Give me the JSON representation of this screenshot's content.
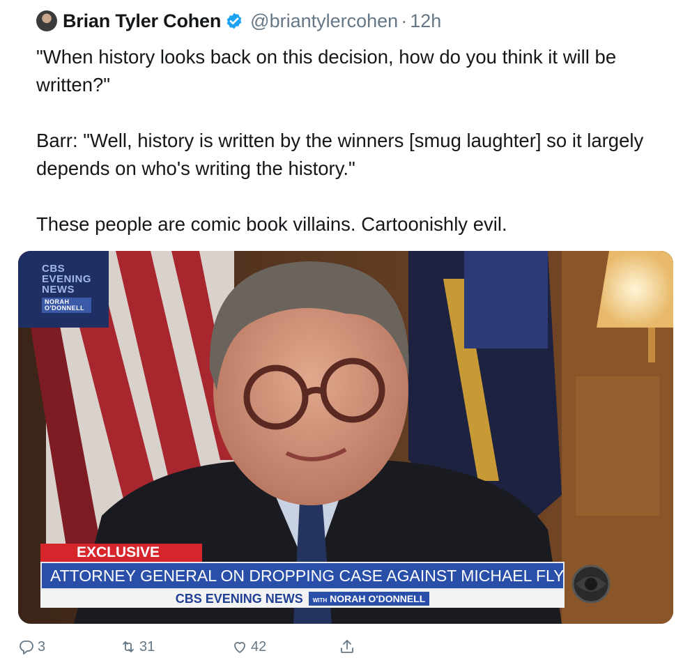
{
  "tweet": {
    "author": {
      "display_name": "Brian Tyler Cohen",
      "handle": "@briantylercohen",
      "separator": "·",
      "time": "12h",
      "verified": true,
      "avatar_icon": "avatar-photo"
    },
    "text": {
      "line1": "\"When history looks back on this decision, how do you think it will be written?\"",
      "line2": "Barr: \"Well, history is written by the winners [smug laughter] so it largely depends on who's writing the history.\"",
      "line3": "These people are comic book villains. Cartoonishly evil."
    },
    "media": {
      "network_logo": {
        "line1": "CBS",
        "line2": "EVENING",
        "line3": "NEWS",
        "anchor_line1": "NORAH",
        "anchor_line2": "O'DONNELL"
      },
      "lower_third": {
        "tag": "EXCLUSIVE",
        "headline": "ATTORNEY GENERAL ON DROPPING CASE AGAINST MICHAEL FLYNN",
        "program": "CBS EVENING NEWS",
        "with_label": "WITH",
        "anchor": "NORAH O'DONNELL"
      }
    },
    "actions": {
      "reply_count": "3",
      "retweet_count": "31",
      "like_count": "42",
      "reply_icon": "reply-icon",
      "retweet_icon": "retweet-icon",
      "like_icon": "heart-icon",
      "share_icon": "share-icon"
    },
    "colors": {
      "text": "#14171a",
      "secondary": "#657786",
      "verified_blue": "#1da1f2",
      "chyron_red": "#d7262b",
      "chyron_blue": "#2a4fa8"
    }
  }
}
